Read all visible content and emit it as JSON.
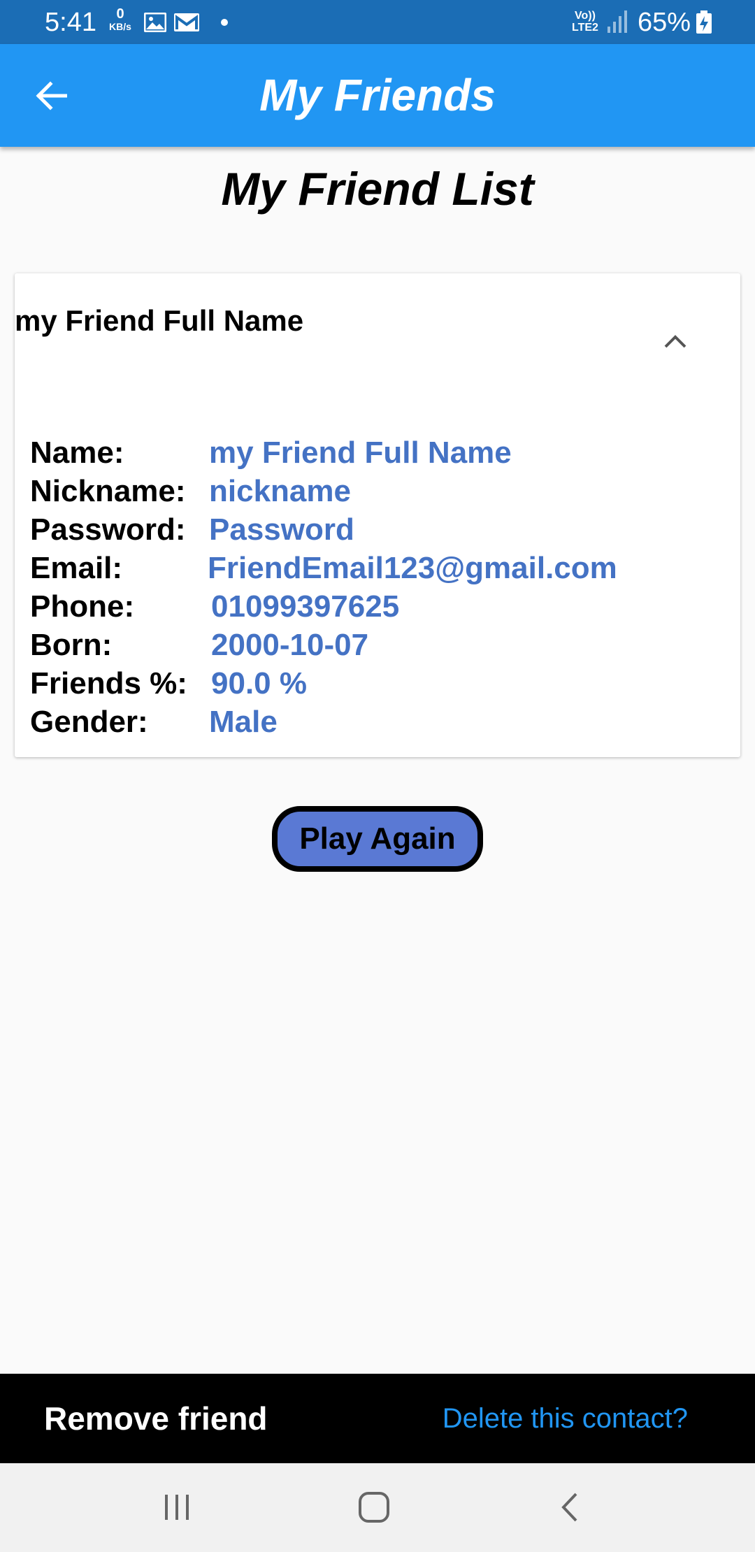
{
  "status_bar": {
    "time": "5:41",
    "data_speed_value": "0",
    "data_speed_unit": "KB/s",
    "network_top": "Vo))",
    "network_bottom": "LTE2",
    "battery_percent": "65%",
    "icons": [
      "gallery-icon",
      "gmail-icon",
      "notification-dot-icon",
      "signal-icon",
      "battery-charging-icon"
    ]
  },
  "app_bar": {
    "title": "My Friends",
    "back_icon": "arrow-left-icon"
  },
  "page": {
    "heading": "My Friend List"
  },
  "friend_card": {
    "title": "my Friend Full Name",
    "collapse_icon": "chevron-up-icon",
    "details": [
      {
        "label": "Name:",
        "value": "my Friend Full Name"
      },
      {
        "label": "Nickname:",
        "value": "nickname"
      },
      {
        "label": "Password:",
        "value": "Password"
      },
      {
        "label": "Email:",
        "value": "FriendEmail123@gmail.com"
      },
      {
        "label": "Phone:",
        "value": "01099397625"
      },
      {
        "label": "Born:",
        "value": "2000-10-07"
      },
      {
        "label": "Friends %:",
        "value": "90.0 %"
      },
      {
        "label": "Gender:",
        "value": "Male"
      }
    ]
  },
  "play_again_button": {
    "label": "Play Again"
  },
  "snackbar": {
    "message": "Remove friend",
    "action": "Delete this contact?"
  },
  "nav_bar": {
    "icons": [
      "recents-icon",
      "home-icon",
      "back-icon"
    ]
  },
  "colors": {
    "status_bar": "#1b6db5",
    "app_bar": "#2196f3",
    "detail_value": "#4472c4",
    "button_fill": "#5a79d4",
    "snackbar_action": "#2196f3"
  }
}
